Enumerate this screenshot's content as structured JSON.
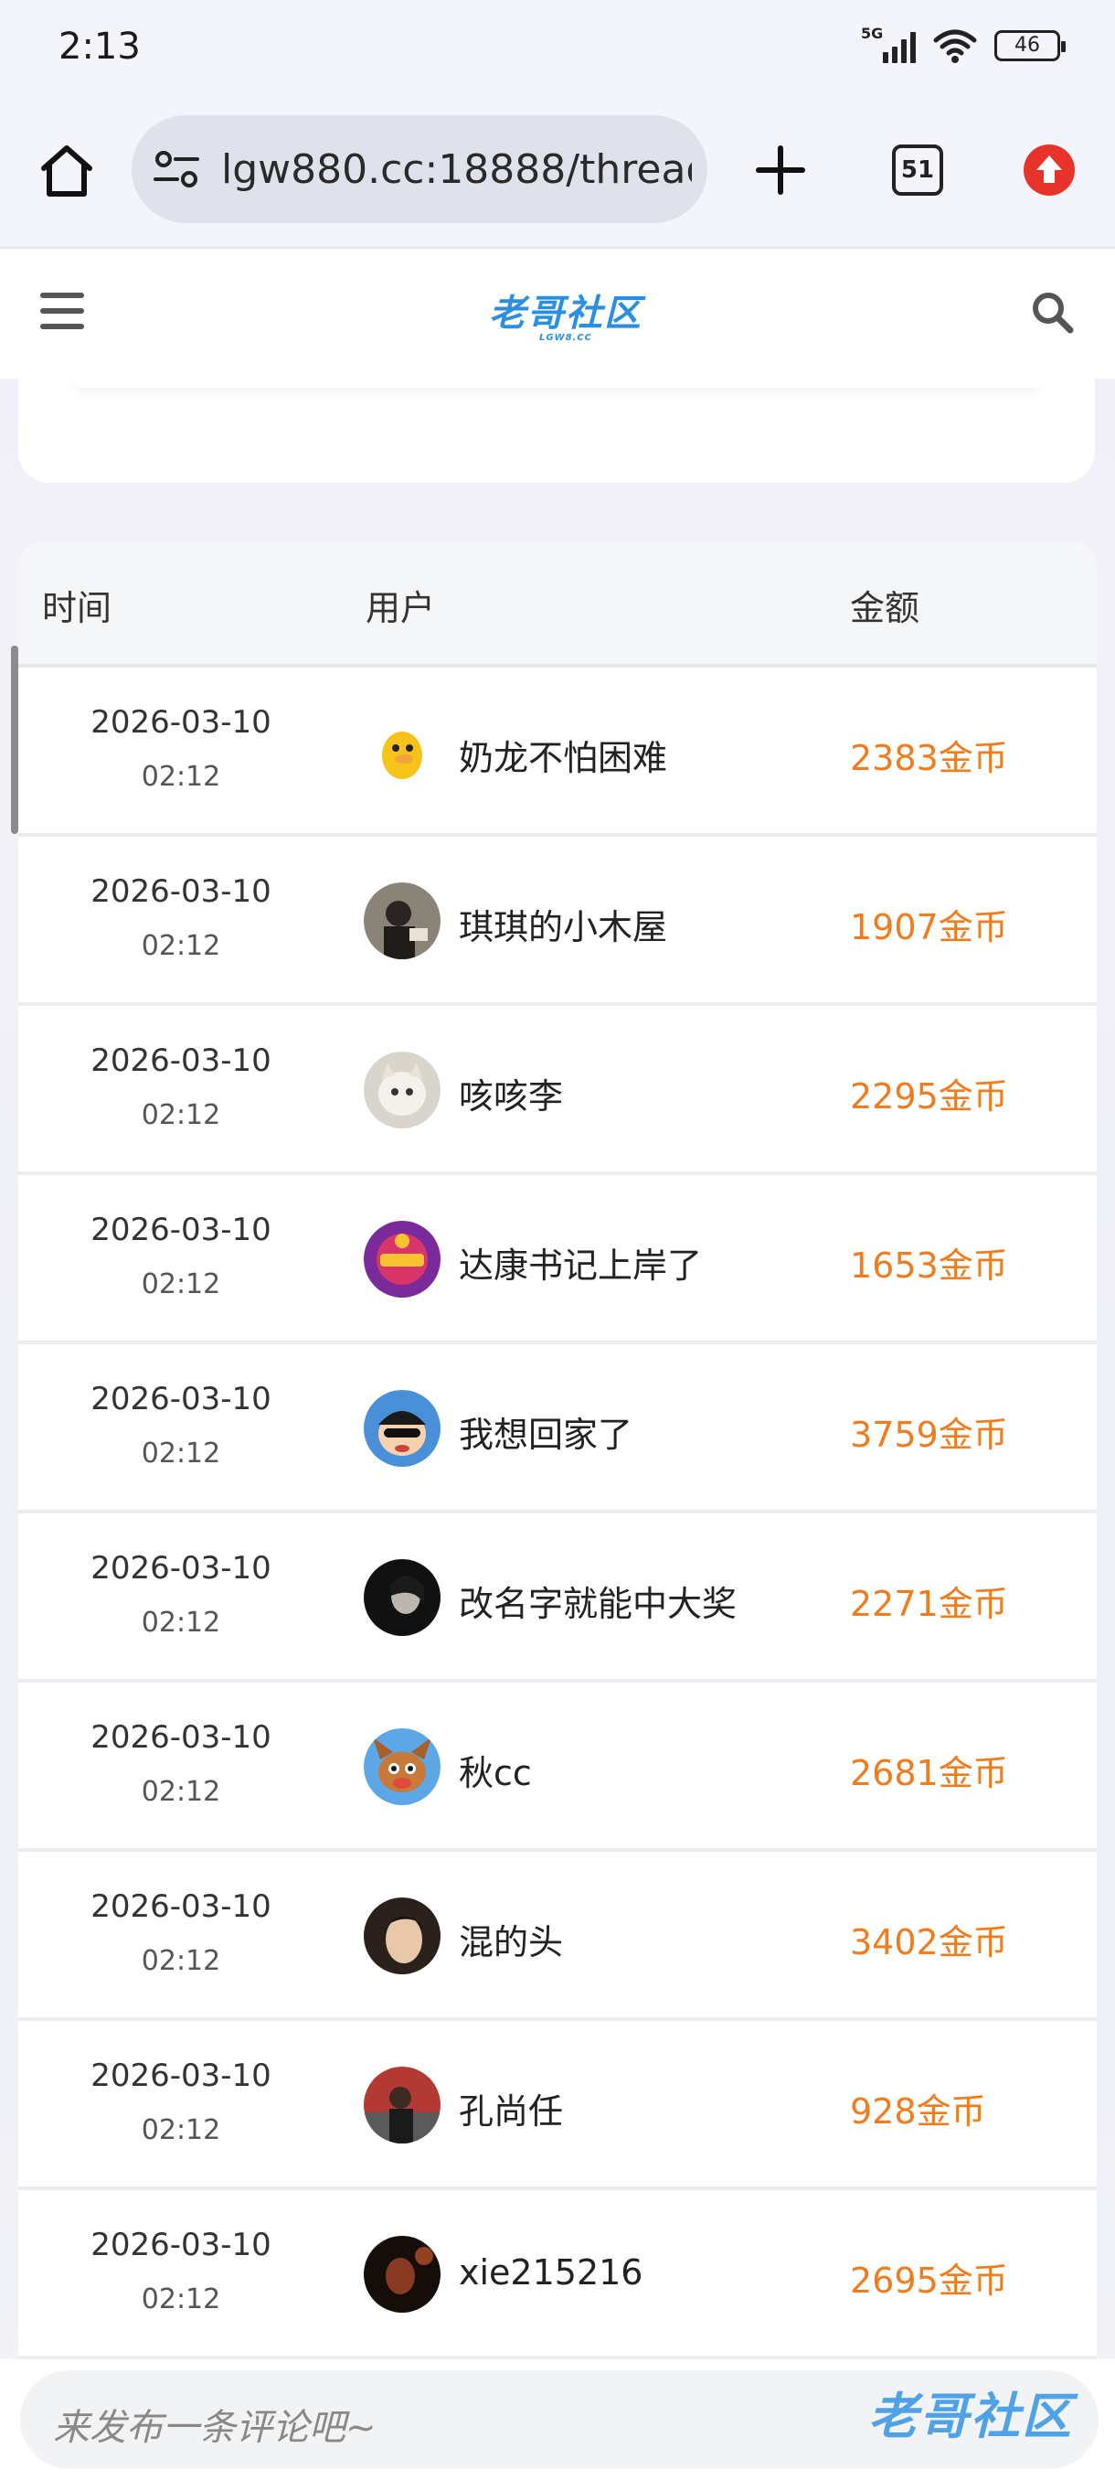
{
  "status_bar": {
    "time": "2:13",
    "network": "5G",
    "battery": "46"
  },
  "browser": {
    "url": "lgw880.cc:18888/thread",
    "tab_count": "51"
  },
  "site": {
    "logo_text": "老哥社区",
    "logo_sub": "LGW8.CC"
  },
  "table": {
    "headers": {
      "time": "时间",
      "user": "用户",
      "amount": "金额"
    },
    "rows": [
      {
        "date": "2026-03-10",
        "clock": "02:12",
        "user": "奶龙不怕困难",
        "amount": "2383金币",
        "avatar": "yellow-duck"
      },
      {
        "date": "2026-03-10",
        "clock": "02:12",
        "user": "琪琪的小木屋",
        "amount": "1907金币",
        "avatar": "photo-person"
      },
      {
        "date": "2026-03-10",
        "clock": "02:12",
        "user": "咳咳李",
        "amount": "2295金币",
        "avatar": "white-cat"
      },
      {
        "date": "2026-03-10",
        "clock": "02:12",
        "user": "达康书记上岸了",
        "amount": "1653金币",
        "avatar": "lucky-badge"
      },
      {
        "date": "2026-03-10",
        "clock": "02:12",
        "user": "我想回家了",
        "amount": "3759金币",
        "avatar": "cartoon-boy"
      },
      {
        "date": "2026-03-10",
        "clock": "02:12",
        "user": "改名字就能中大奖",
        "amount": "2271金币",
        "avatar": "dark-portrait"
      },
      {
        "date": "2026-03-10",
        "clock": "02:12",
        "user": "秋cc",
        "amount": "2681金币",
        "avatar": "cartoon-dog"
      },
      {
        "date": "2026-03-10",
        "clock": "02:12",
        "user": "混的头",
        "amount": "3402金币",
        "avatar": "face-portrait"
      },
      {
        "date": "2026-03-10",
        "clock": "02:12",
        "user": "孔尚任",
        "amount": "928金币",
        "avatar": "photo-street"
      },
      {
        "date": "2026-03-10",
        "clock": "02:12",
        "user": "xie215216",
        "amount": "2695金币",
        "avatar": "night-portrait"
      }
    ]
  },
  "comment": {
    "placeholder": "来发布一条评论吧~"
  },
  "watermark": "老哥社区",
  "colors": {
    "amount": "#f07c1e",
    "accent": "#2a8fe0",
    "update": "#e8332a"
  }
}
